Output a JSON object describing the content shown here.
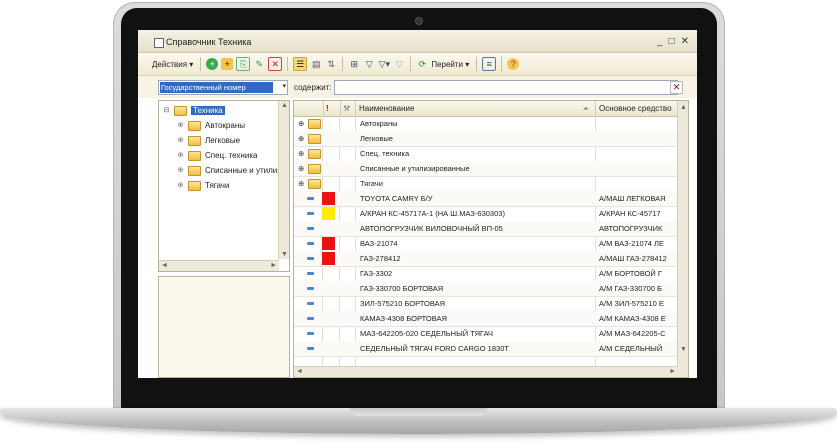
{
  "window": {
    "title": "Справочник  Техника",
    "controls": [
      "_",
      "□",
      "✕"
    ]
  },
  "toolbar": {
    "actions_label": "Действия",
    "goto_label": "Перейти",
    "icons": [
      "add-icon",
      "add-folder-icon",
      "copy-icon",
      "edit-icon",
      "delete-icon",
      "tree-icon",
      "list-icon",
      "hierarchy-icon",
      "filter-icon",
      "filter-apply-icon",
      "filter-list-icon",
      "filter-clear-icon",
      "refresh-icon",
      "report-icon",
      "help-icon"
    ]
  },
  "filter": {
    "field_value": "Государственный номер",
    "contains_label": "содержит:",
    "value": ""
  },
  "tree": {
    "root": "Техника",
    "items": [
      "Автокраны",
      "Легковые",
      "Спец. техника",
      "Списанные и утилиз",
      "Тягачи"
    ]
  },
  "table": {
    "columns": [
      "Наименование",
      "Основное средство"
    ],
    "folders": [
      "Автокраны",
      "Легковые",
      "Спец. техника",
      "Списанные и утилизированные",
      "Тягачи"
    ],
    "rows": [
      {
        "name": "TOYOTA CAMRY Б/У",
        "asset": "А/МАШ ЛЕГКОВАЯ",
        "mark": "#ee1111"
      },
      {
        "name": "А/КРАН КС-45717А-1 (НА Ш.МАЗ-630303)",
        "asset": "А/КРАН КС-45717",
        "mark": "#ffee00"
      },
      {
        "name": "АВТОПОГРУЗЧИК ВИЛОВОЧНЫЙ ВП-05",
        "asset": "АВТОПОГРУЗЧИК",
        "mark": ""
      },
      {
        "name": "ВАЗ-21074",
        "asset": "А/М ВАЗ-21074 ЛЕ",
        "mark": "#ee1111"
      },
      {
        "name": "ГАЗ-278412",
        "asset": "А/МАШ ГАЗ-278412",
        "mark": "#ee1111"
      },
      {
        "name": "ГАЗ-3302",
        "asset": "А/М БОРТОВОЙ Г",
        "mark": ""
      },
      {
        "name": "ГАЗ-330700 БОРТОВАЯ",
        "asset": "А/М ГАЗ-330700 Б",
        "mark": ""
      },
      {
        "name": "ЗИЛ-575210 БОРТОВАЯ",
        "asset": "А/М ЗИЛ-575210 Е",
        "mark": ""
      },
      {
        "name": "КАМАЗ-4308 БОРТОВАЯ",
        "asset": "А/М КАМАЗ-4308 Е",
        "mark": ""
      },
      {
        "name": "МАЗ-642205-020 СЕДЕЛЬНЫЙ ТЯГАЧ",
        "asset": "А/М МАЗ-642205-С",
        "mark": ""
      },
      {
        "name": "СЕДЕЛЬНЫЙ ТЯГАЧ FORD CARGO 1830T",
        "asset": "А/М СЕДЕЛЬНЫЙ",
        "mark": ""
      }
    ]
  },
  "colors": {
    "selection": "#3169c6",
    "header_bg": "#efead3",
    "status_red": "#ee1111",
    "status_yellow": "#ffee00"
  }
}
